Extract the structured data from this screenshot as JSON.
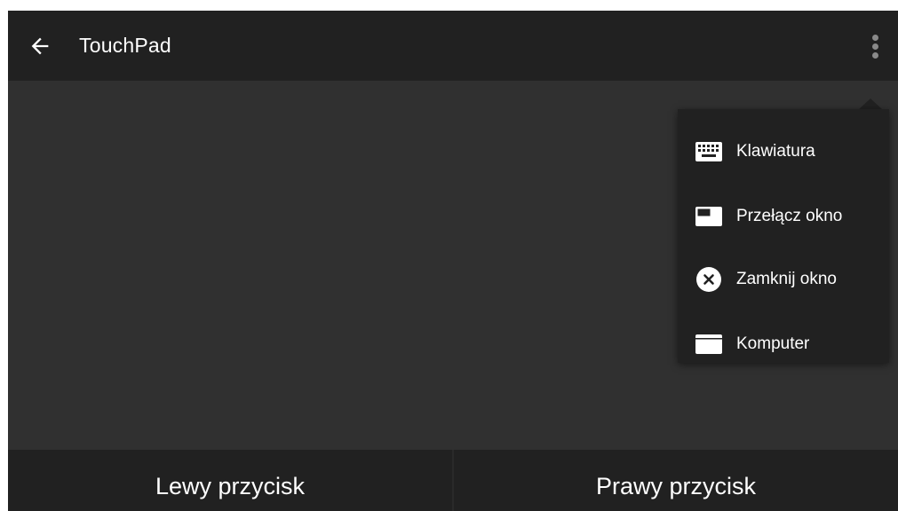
{
  "app_bar": {
    "title": "TouchPad",
    "back_icon": "arrow-left-icon",
    "overflow_icon": "more-vert-icon"
  },
  "menu": {
    "items": [
      {
        "label": "Klawiatura",
        "icon": "keyboard-icon"
      },
      {
        "label": "Przełącz okno",
        "icon": "switch-window-icon"
      },
      {
        "label": "Zamknij okno",
        "icon": "close-circle-icon"
      },
      {
        "label": "Komputer",
        "icon": "computer-icon"
      }
    ]
  },
  "bottom_bar": {
    "left_button": "Lewy przycisk",
    "right_button": "Prawy przycisk"
  },
  "colors": {
    "app_bar_bg": "#212121",
    "touch_area_bg": "#303030",
    "menu_bg": "#212121",
    "text": "#ffffff"
  }
}
